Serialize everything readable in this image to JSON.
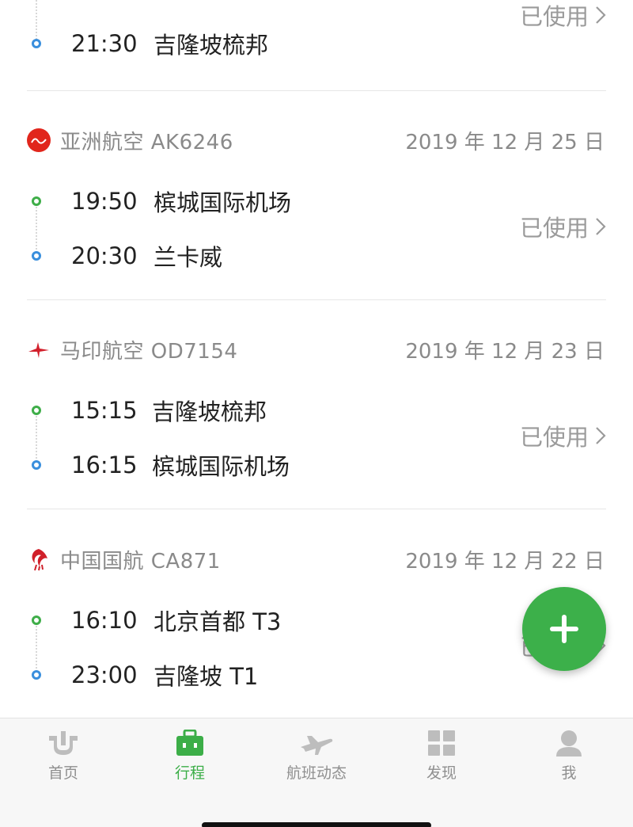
{
  "trips": [
    {
      "airline": "",
      "date": "",
      "status": "已使用",
      "segments": [
        {
          "time": "21:30",
          "place": "吉隆坡梳邦"
        }
      ]
    },
    {
      "airline": "亚洲航空 AK6246",
      "logo": "airasia-logo",
      "date": "2019 年 12 月 25 日",
      "status": "已使用",
      "segments": [
        {
          "time": "19:50",
          "place": "槟城国际机场"
        },
        {
          "time": "20:30",
          "place": "兰卡威"
        }
      ]
    },
    {
      "airline": "马印航空 OD7154",
      "logo": "malindo-logo",
      "date": "2019 年 12 月 23 日",
      "status": "已使用",
      "segments": [
        {
          "time": "15:15",
          "place": "吉隆坡梳邦"
        },
        {
          "time": "16:15",
          "place": "槟城国际机场"
        }
      ]
    },
    {
      "airline": "中国国航 CA871",
      "logo": "air-china-logo",
      "date": "2019 年 12 月 22 日",
      "status": "已使用",
      "segments": [
        {
          "time": "16:10",
          "place": "北京首都 T3"
        },
        {
          "time": "23:00",
          "place": "吉隆坡 T1"
        }
      ]
    }
  ],
  "fab": {
    "icon": "plus-icon"
  },
  "tabbar": {
    "tabs": [
      {
        "label": "首页",
        "icon": "home-icon"
      },
      {
        "label": "行程",
        "icon": "briefcase-icon",
        "active": true
      },
      {
        "label": "航班动态",
        "icon": "plane-icon"
      },
      {
        "label": "发现",
        "icon": "grid-icon"
      },
      {
        "label": "我",
        "icon": "person-icon"
      }
    ]
  },
  "colors": {
    "accent": "#3cb04a",
    "arrival_dot": "#3a8fdd",
    "secondary_text": "#8a8a8a"
  }
}
